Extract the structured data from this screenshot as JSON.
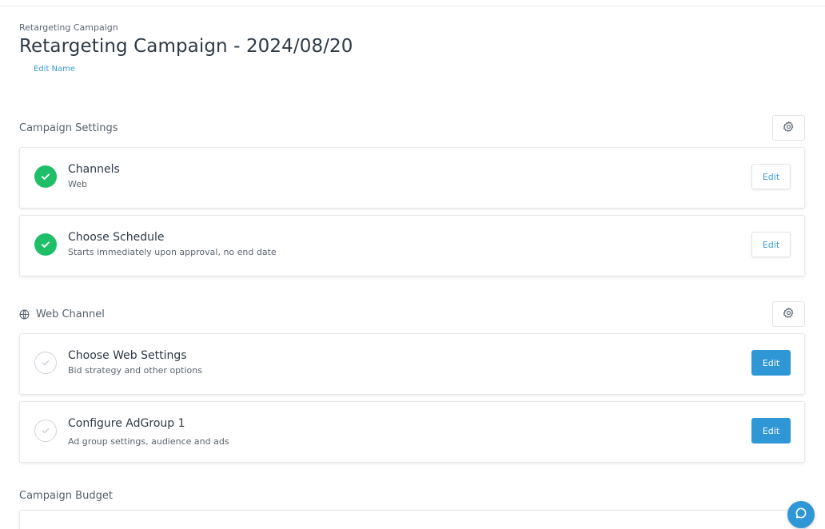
{
  "breadcrumb": "Retargeting Campaign",
  "title": "Retargeting Campaign - 2024/08/20",
  "edit_name": "Edit Name",
  "sections": {
    "campaign_settings": {
      "label": "Campaign Settings",
      "icon": "gear-icon",
      "cards": [
        {
          "title": "Channels",
          "subtitle": "Web",
          "status": "done",
          "button": "Edit",
          "button_style": "secondary"
        },
        {
          "title": "Choose Schedule",
          "subtitle": "Starts immediately upon approval, no end date",
          "status": "done",
          "button": "Edit",
          "button_style": "secondary"
        }
      ]
    },
    "web_channel": {
      "label": "Web Channel",
      "icon": "globe-icon",
      "cards": [
        {
          "title": "Choose Web Settings",
          "subtitle": "Bid strategy and other options",
          "status": "todo",
          "button": "Edit",
          "button_style": "primary"
        },
        {
          "title": "Configure AdGroup 1",
          "subtitle": "Ad group settings, audience and ads",
          "status": "todo",
          "button": "Edit",
          "button_style": "primary"
        }
      ]
    },
    "campaign_budget": {
      "label": "Campaign Budget"
    }
  },
  "colors": {
    "accent": "#2f97d6",
    "success": "#1fbf6a",
    "link": "#3a9bd8"
  }
}
